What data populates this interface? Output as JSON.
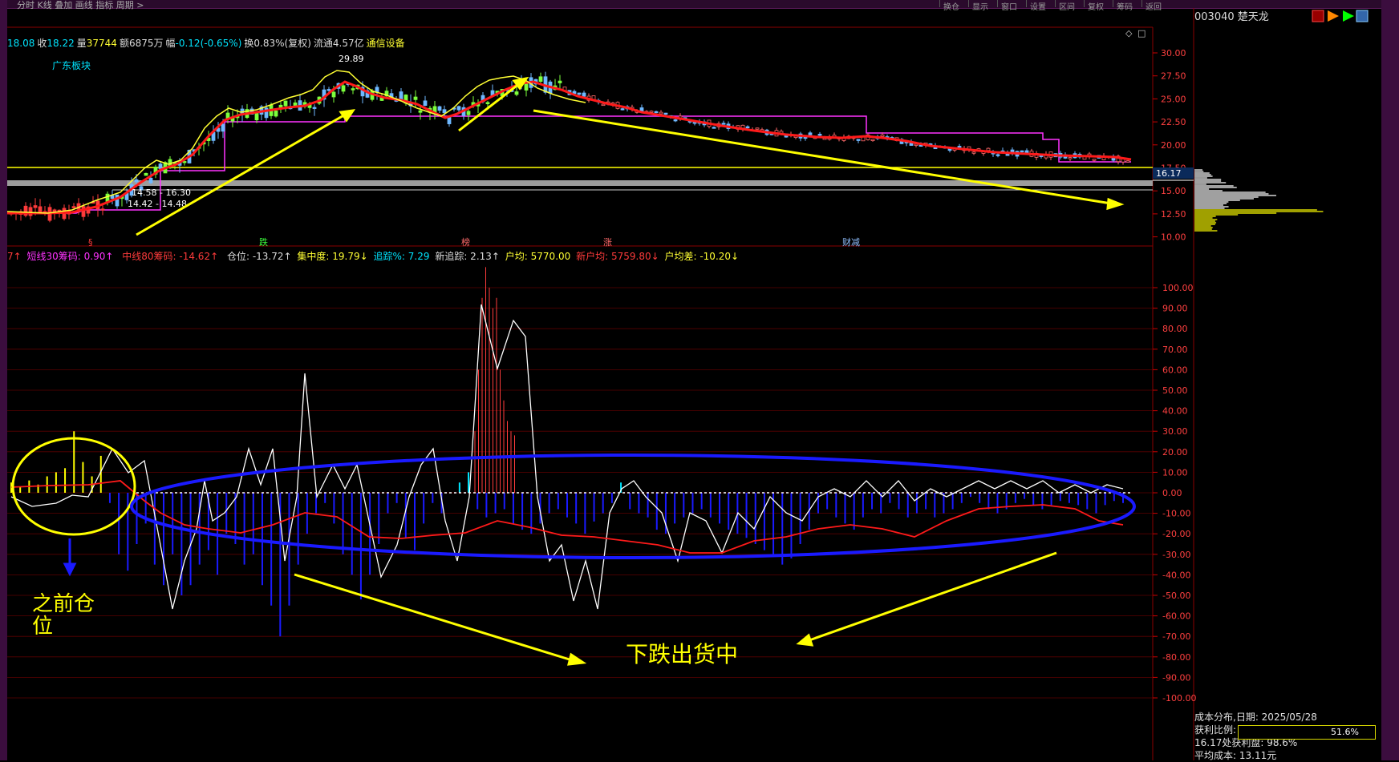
{
  "toolbar": {
    "menu": "分时  K线  叠加  画线  指标  周期  >",
    "right_buttons": [
      "换仓",
      "显示",
      "窗口",
      "设置",
      "区间",
      "复权",
      "筹码",
      "返回"
    ]
  },
  "stock": {
    "code": "003040",
    "name": "楚天龙"
  },
  "quote": {
    "open": "18.08",
    "close_label": "收",
    "close": "18.22",
    "volume_label": "量",
    "volume": "37744",
    "amount_label": "额",
    "amount": "6875万",
    "change_label": "幅",
    "change": "-0.12(-0.65%)",
    "turnover": "换0.83%(复权)",
    "float_cap": "流通4.57亿",
    "industry": "通信设备"
  },
  "sector_label": "广东板块",
  "indicator_line": {
    "prefix": "7↑",
    "short30": "短线30筹码: 0.90↑",
    "mid80": "中线80筹码: -14.62↑",
    "position": "仓位: -13.72↑",
    "concentration": "集中度: 19.79↓",
    "tracking": "追踪%: 7.29",
    "new_tracking": "新追踪: 2.13↑",
    "avg_holding": "户均: 5770.00",
    "new_avg": "新户均: 5759.80↓",
    "avg_diff": "户均差: -10.20↓"
  },
  "price_axis": [
    "30.00",
    "27.50",
    "25.00",
    "22.50",
    "20.00",
    "17.50",
    "15.00",
    "12.50",
    "10.00"
  ],
  "price_tag": "16.17",
  "high_marker": "29.89",
  "range_labels": [
    "14.58 - 16.30",
    "14.42 - 14.48"
  ],
  "event_marks": [
    {
      "text": "§",
      "color": "#ff3b3b"
    },
    {
      "text": "跌",
      "color": "#3cff3c"
    },
    {
      "text": "榜",
      "color": "#ff6a6a"
    },
    {
      "text": "涨",
      "color": "#ff6a6a"
    },
    {
      "text": "财减",
      "color": "#8fbfff"
    }
  ],
  "indicator_axis": [
    "100.00",
    "90.00",
    "80.00",
    "70.00",
    "60.00",
    "50.00",
    "40.00",
    "30.00",
    "20.00",
    "10.00",
    "0.00",
    "-10.00",
    "-20.00",
    "-30.00",
    "-40.00",
    "-50.00",
    "-60.00",
    "-70.00",
    "-80.00",
    "-90.00",
    "-100.00"
  ],
  "annotations": {
    "before_position": "之前仓\n位",
    "falling_shipping": "下跌出货中"
  },
  "cost_info": {
    "date_line": "成本分布,日期: 2025/05/28",
    "profit_label": "获利比例:",
    "profit_value": "51.6%",
    "profit_fraction": 0.516,
    "price_profit": "16.17处获利盘: 98.6%",
    "avg_cost": "平均成本: 13.11元"
  },
  "colors": {
    "background": "#000000",
    "frame": "#3b0d3e",
    "up": "#ff3b3b",
    "down": "#00e5ff",
    "ma_red": "#ff1a1a",
    "ma_yellow": "#ffff33",
    "channel": "#ff33ff",
    "annotation_yellow": "#ffff00",
    "annotation_blue": "#1a1aff",
    "grid": "#7a0000"
  }
}
